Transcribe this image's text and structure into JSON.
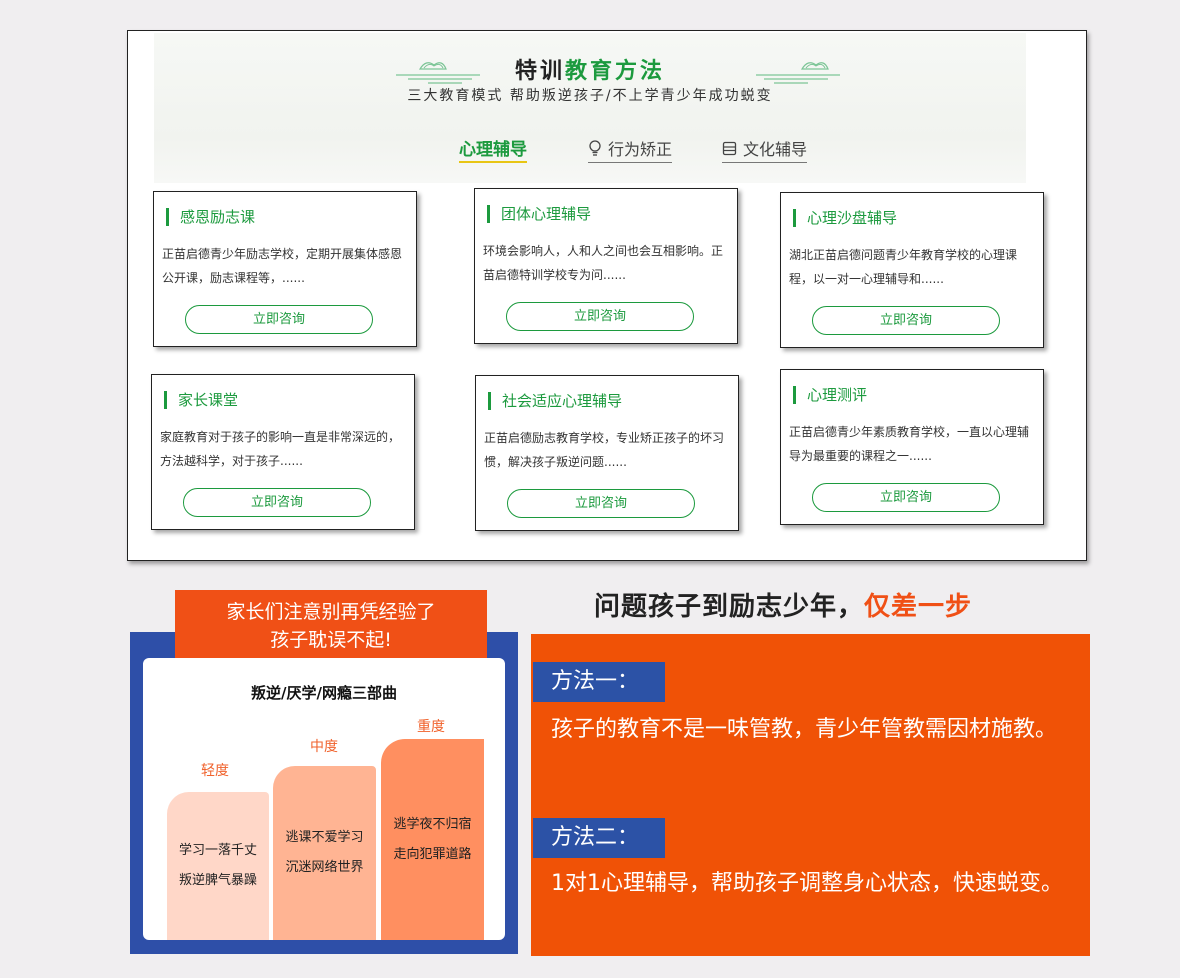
{
  "section_title": {
    "part1": "特训",
    "part2": "教育方法"
  },
  "subtitle": "三大教育模式 帮助叛逆孩子/不上学青少年成功蜕变",
  "tabs": [
    {
      "label": "心理辅导",
      "icon": "none"
    },
    {
      "label": "行为矫正",
      "icon": "bulb-icon"
    },
    {
      "label": "文化辅导",
      "icon": "book-icon"
    }
  ],
  "cards": [
    {
      "title": "感恩励志课",
      "desc": "正苗启德青少年励志学校，定期开展集体感恩公开课，励志课程等，......",
      "button": "立即咨询"
    },
    {
      "title": "团体心理辅导",
      "desc": "环境会影响人，人和人之间也会互相影响。正苗启德特训学校专为问......",
      "button": "立即咨询"
    },
    {
      "title": "心理沙盘辅导",
      "desc": "湖北正苗启德问题青少年教育学校的心理课程，以一对一心理辅导和......",
      "button": "立即咨询"
    },
    {
      "title": "家长课堂",
      "desc": "家庭教育对于孩子的影响一直是非常深远的，方法越科学，对于孩子......",
      "button": "立即咨询"
    },
    {
      "title": "社会适应心理辅导",
      "desc": "正苗启德励志教育学校，专业矫正孩子的坏习惯，解决孩子叛逆问题......",
      "button": "立即咨询"
    },
    {
      "title": "心理测评",
      "desc": "正苗启德青少年素质教育学校，一直以心理辅导为最重要的课程之一......",
      "button": "立即咨询"
    }
  ],
  "warning": {
    "line1": "家长们注意别再凭经验了",
    "line2": "孩子耽误不起!",
    "stair_title": "叛逆/厌学/网瘾三部曲",
    "levels": [
      {
        "label": "轻度",
        "line1": "学习一落千丈",
        "line2": "叛逆脾气暴躁"
      },
      {
        "label": "中度",
        "line1": "逃课不爱学习",
        "line2": "沉迷网络世界"
      },
      {
        "label": "重度",
        "line1": "逃学夜不归宿",
        "line2": "走向犯罪道路"
      }
    ]
  },
  "headline": {
    "part1": "问题孩子到励志少年，",
    "part2": "仅差一步"
  },
  "methods": [
    {
      "label": "方法一：",
      "text": "孩子的教育不是一味管教，青少年管教需因材施教。"
    },
    {
      "label": "方法二：",
      "text": "1对1心理辅导，帮助孩子调整身心状态，快速蜕变。"
    }
  ],
  "colors": {
    "green": "#1c9a3e",
    "orange": "#f05016",
    "blue": "#2e4fa8",
    "tab_underline": "#e8c514"
  }
}
